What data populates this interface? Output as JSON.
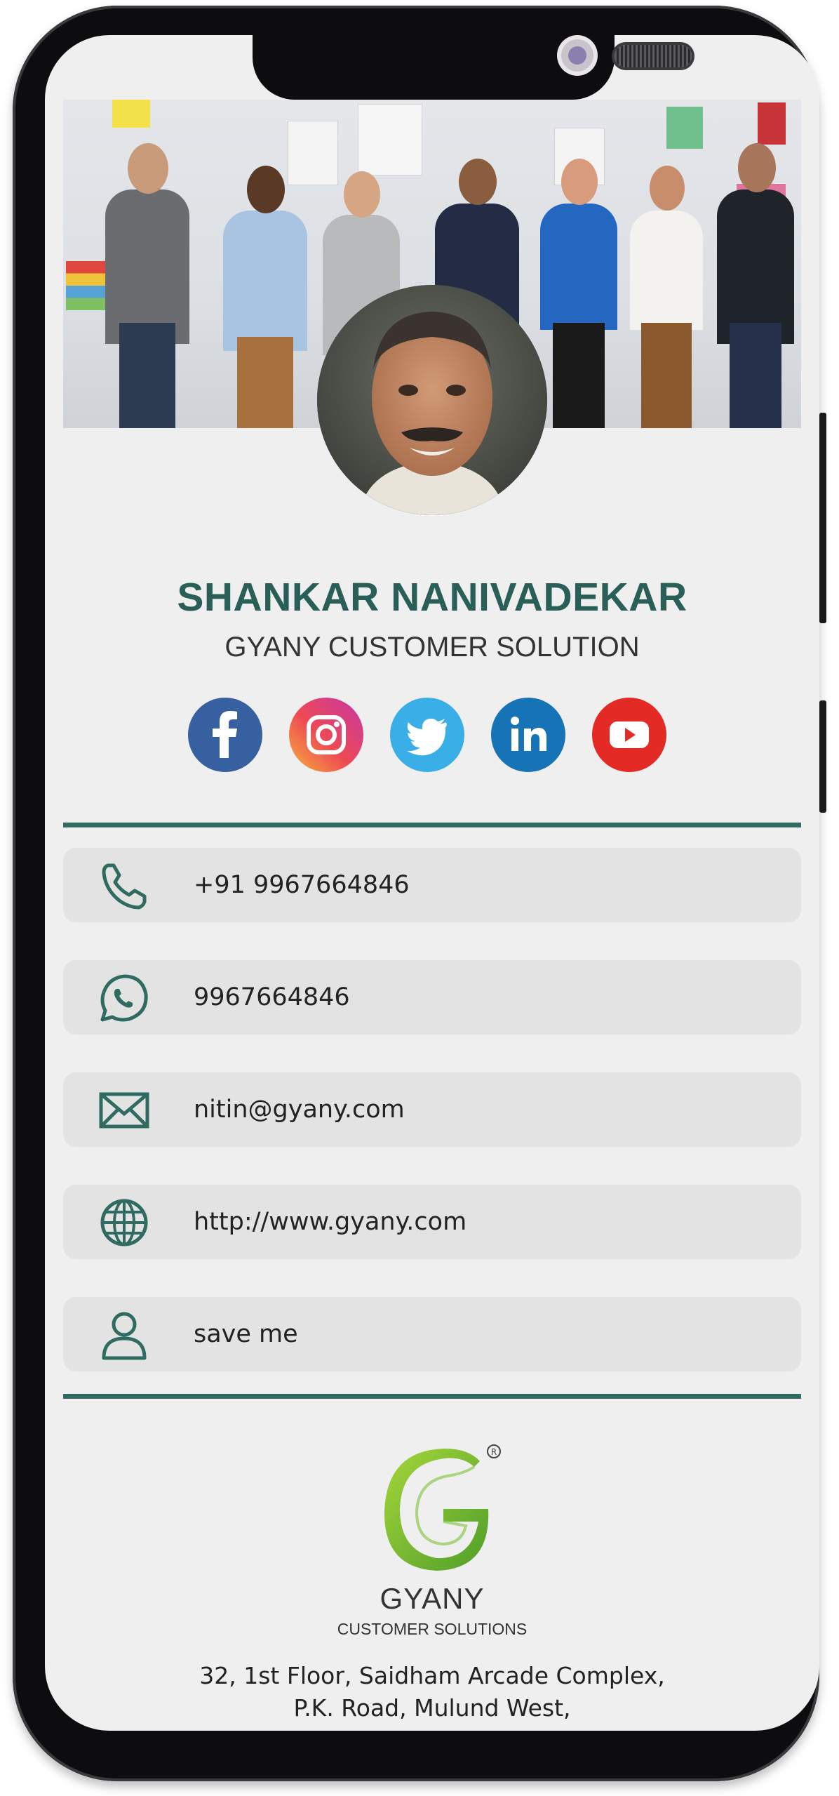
{
  "profile": {
    "name": "SHANKAR NANIVADEKAR",
    "company": "GYANY CUSTOMER SOLUTION"
  },
  "socials": [
    {
      "name": "facebook",
      "icon": "facebook-icon",
      "color": "#3b5998"
    },
    {
      "name": "instagram",
      "icon": "instagram-icon",
      "color": "#d6249f"
    },
    {
      "name": "twitter",
      "icon": "twitter-icon",
      "color": "#1da1f2"
    },
    {
      "name": "linkedin",
      "icon": "linkedin-icon",
      "color": "#0e76a8"
    },
    {
      "name": "youtube",
      "icon": "youtube-icon",
      "color": "#e62117"
    }
  ],
  "contacts": {
    "phone": {
      "label": "+91 9967664846",
      "icon": "phone-icon"
    },
    "whatsapp": {
      "label": "9967664846",
      "icon": "whatsapp-icon"
    },
    "email": {
      "label": "nitin@gyany.com",
      "icon": "mail-icon"
    },
    "website": {
      "label": "http://www.gyany.com",
      "icon": "globe-icon"
    },
    "save": {
      "label": "save me",
      "icon": "user-icon"
    }
  },
  "footer": {
    "brand": "GYANY",
    "brand_sub": "CUSTOMER SOLUTIONS",
    "address_line1": "32, 1st Floor, Saidham Arcade Complex,",
    "address_line2": "P.K. Road, Mulund West,"
  },
  "theme": {
    "accent": "#2f6b60",
    "background": "#f0eff0",
    "row_bg": "#e4e3e4"
  }
}
